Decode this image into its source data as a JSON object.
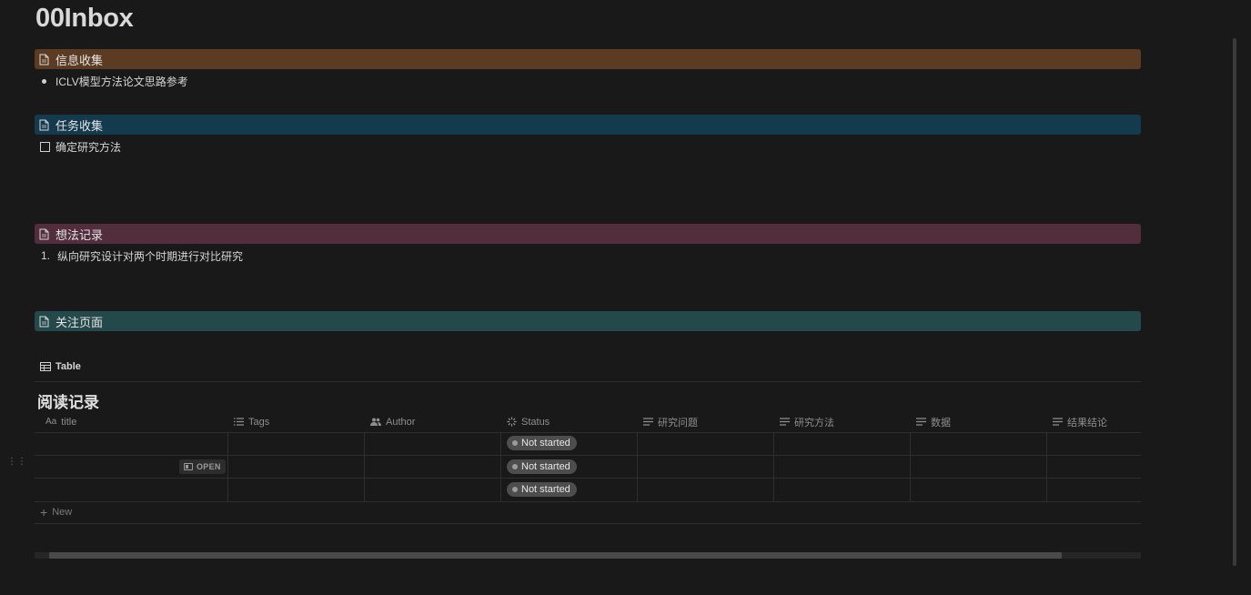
{
  "page": {
    "title": "00Inbox"
  },
  "sections": {
    "info": {
      "heading": "信息收集",
      "items": [
        "ICLV模型方法论文思路参考"
      ]
    },
    "tasks": {
      "heading": "任务收集",
      "items": [
        "确定研究方法"
      ]
    },
    "ideas": {
      "heading": "想法记录",
      "items": [
        {
          "number": "1.",
          "text": "纵向研究设计对两个时期进行对比研究"
        }
      ]
    },
    "watch": {
      "heading": "关注页面"
    }
  },
  "database": {
    "view_tab": "Table",
    "title": "阅读记录",
    "columns": [
      {
        "label": "title",
        "icon": "text-aa-icon"
      },
      {
        "label": "Tags",
        "icon": "list-icon"
      },
      {
        "label": "Author",
        "icon": "people-icon"
      },
      {
        "label": "Status",
        "icon": "status-spinner-icon"
      },
      {
        "label": "研究问题",
        "icon": "text-lines-icon"
      },
      {
        "label": "研究方法",
        "icon": "text-lines-icon"
      },
      {
        "label": "数据",
        "icon": "text-lines-icon"
      },
      {
        "label": "结果结论",
        "icon": "text-lines-icon"
      }
    ],
    "rows": [
      {
        "status": "Not started"
      },
      {
        "status": "Not started"
      },
      {
        "status": "Not started"
      }
    ],
    "open_label": "OPEN",
    "new_label": "New"
  },
  "colors": {
    "background": "#191919",
    "callout_brown": "#5c3b23",
    "callout_blue": "#143a4e",
    "callout_pink": "#522e3c",
    "callout_teal": "#24494a",
    "status_pill": "#4d4d4d"
  }
}
